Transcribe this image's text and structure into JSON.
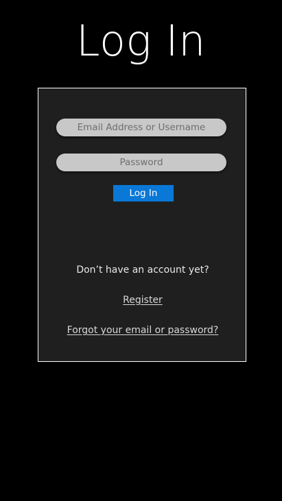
{
  "header": {
    "title": "Log In"
  },
  "form": {
    "email_placeholder": "Email Address or Username",
    "password_placeholder": "Password",
    "login_button_label": "Log In",
    "no_account_text": "Don’t have an account yet?",
    "register_link": "Register",
    "forgot_link": "Forgot your email or password?"
  },
  "colors": {
    "background": "#000000",
    "panel": "#1f1f1f",
    "panel_border": "#ffffff",
    "field_background": "#c8c8c8",
    "accent": "#0a78d7"
  }
}
